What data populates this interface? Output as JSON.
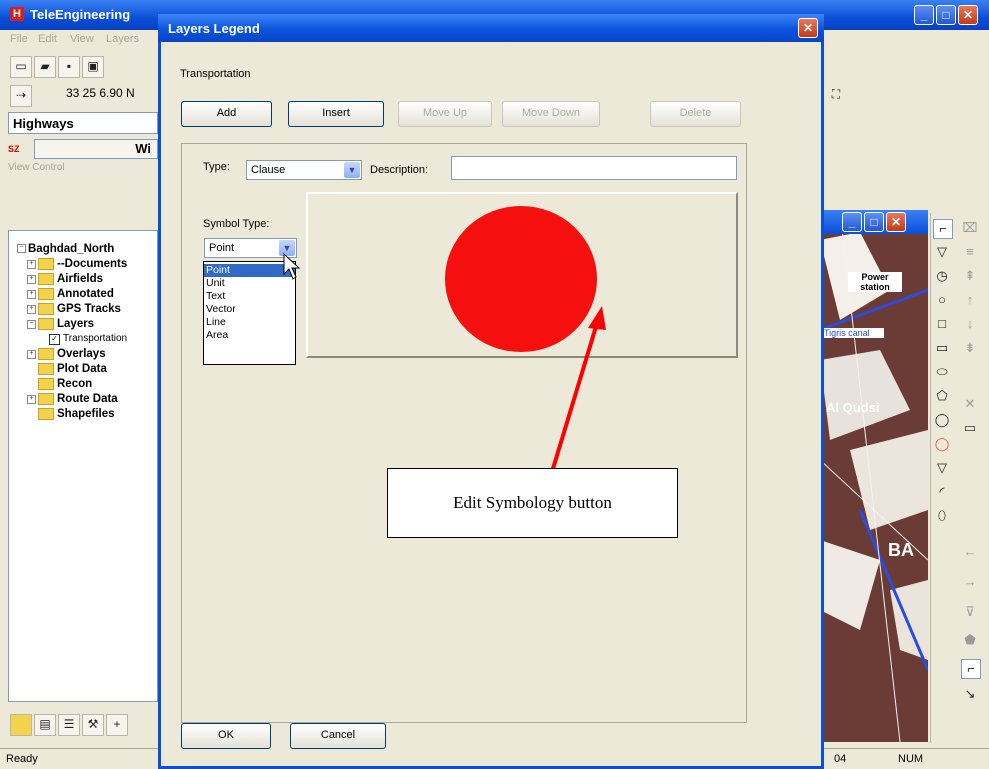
{
  "app": {
    "title": "TeleEngineering",
    "logo_letter": "H",
    "menu": [
      "File",
      "Edit",
      "View",
      "Layers"
    ],
    "coordinate": "33 25  6.90 N",
    "layer_name": "Highways",
    "layer_prefix": "SZ",
    "layer_button_label": "Wi",
    "view_control_label": "View Control",
    "tree": {
      "root": "Baghdad_North",
      "items": [
        {
          "label": "--Documents",
          "expandable": true
        },
        {
          "label": "Airfields",
          "expandable": true
        },
        {
          "label": "Annotated",
          "expandable": true
        },
        {
          "label": "GPS Tracks",
          "expandable": true
        },
        {
          "label": "Layers",
          "expandable": true
        },
        {
          "label": "Transportation",
          "expandable": false,
          "checked": true
        },
        {
          "label": "Overlays",
          "expandable": true
        },
        {
          "label": "Plot Data",
          "expandable": false
        },
        {
          "label": "Recon",
          "expandable": false
        },
        {
          "label": "Route Data",
          "expandable": true
        },
        {
          "label": "Shapefiles",
          "expandable": false
        }
      ]
    },
    "status": {
      "left": "Ready",
      "mid": "04",
      "right": "NUM"
    },
    "map_labels": [
      "Power station",
      "Tigris canal",
      "Al Qudsi",
      "BA"
    ]
  },
  "dialog": {
    "title": "Layers Legend",
    "layer": "Transportation",
    "buttons": {
      "add": "Add",
      "insert": "Insert",
      "move_up": "Move Up",
      "move_down": "Move Down",
      "delete": "Delete",
      "ok": "OK",
      "cancel": "Cancel"
    },
    "type_label": "Type:",
    "type_value": "Clause",
    "description_label": "Description:",
    "description_value": "",
    "symbol_type_label": "Symbol Type:",
    "symbol_type_value": "Point",
    "symbol_type_options": [
      "Point",
      "Unit",
      "Text",
      "Vector",
      "Line",
      "Area"
    ],
    "symbol_color": "#f50f0f"
  },
  "annotation": {
    "callout_text": "Edit Symbology button",
    "arrow_color": "#ff0000"
  }
}
